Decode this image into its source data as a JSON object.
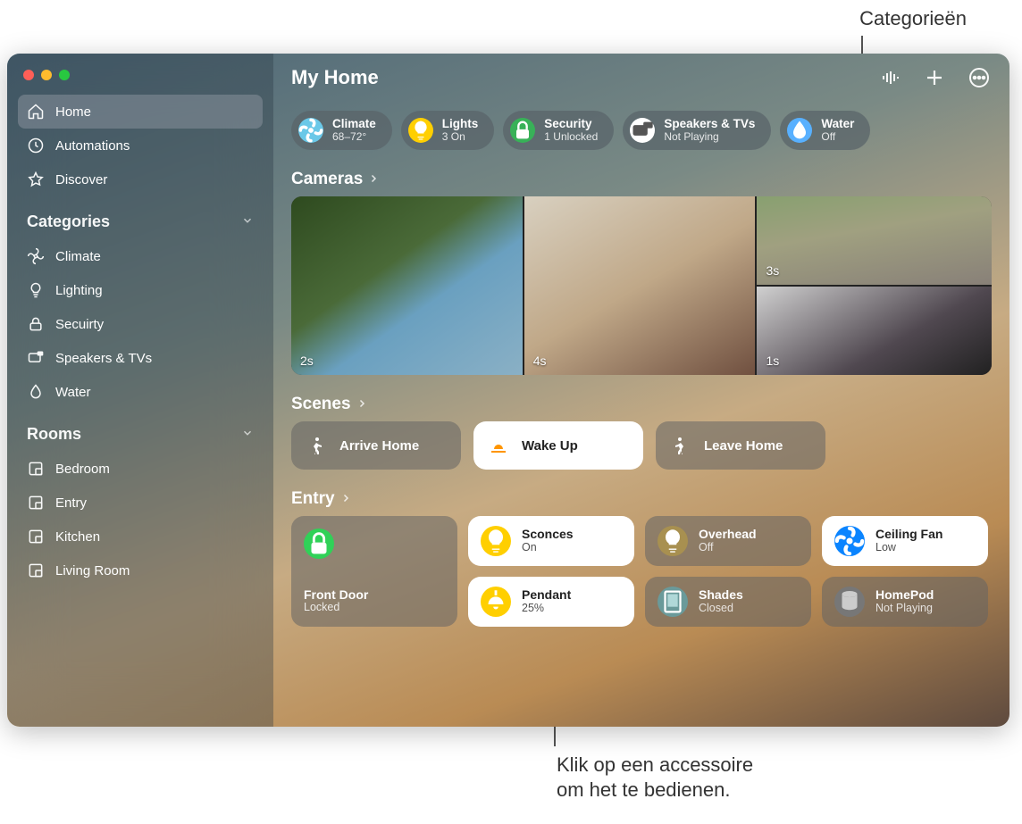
{
  "callouts": {
    "top": "Categorieën",
    "bottom1": "Klik op een accessoire",
    "bottom2": "om het te bedienen."
  },
  "title": "My Home",
  "sidebar": {
    "main": [
      {
        "label": "Home"
      },
      {
        "label": "Automations"
      },
      {
        "label": "Discover"
      }
    ],
    "categories_head": "Categories",
    "categories": [
      {
        "label": "Climate"
      },
      {
        "label": "Lighting"
      },
      {
        "label": "Secuirty"
      },
      {
        "label": "Speakers & TVs"
      },
      {
        "label": "Water"
      }
    ],
    "rooms_head": "Rooms",
    "rooms": [
      {
        "label": "Bedroom"
      },
      {
        "label": "Entry"
      },
      {
        "label": "Kitchen"
      },
      {
        "label": "Living Room"
      }
    ]
  },
  "pills": [
    {
      "label": "Climate",
      "status": "68–72°",
      "color": "#6ac8e8"
    },
    {
      "label": "Lights",
      "status": "3 On",
      "color": "#ffcf00"
    },
    {
      "label": "Security",
      "status": "1 Unlocked",
      "color": "#38b158"
    },
    {
      "label": "Speakers & TVs",
      "status": "Not Playing",
      "color": "#ffffff"
    },
    {
      "label": "Water",
      "status": "Off",
      "color": "#0a84ff"
    }
  ],
  "sections": {
    "cameras": "Cameras",
    "scenes": "Scenes",
    "entry": "Entry"
  },
  "cameras": [
    {
      "label": "2s"
    },
    {
      "label": "3s"
    },
    {
      "label": "4s"
    },
    {
      "label": "1s"
    }
  ],
  "scenes": [
    {
      "label": "Arrive Home",
      "style": "dark"
    },
    {
      "label": "Wake Up",
      "style": "light"
    },
    {
      "label": "Leave Home",
      "style": "dark"
    }
  ],
  "entry": {
    "front_door": {
      "name": "Front Door",
      "status": "Locked"
    },
    "tiles": [
      {
        "name": "Sconces",
        "status": "On",
        "style": "light",
        "icon": "bulb",
        "iclass": "ic-yellow"
      },
      {
        "name": "Overhead",
        "status": "Off",
        "style": "dark",
        "icon": "bulb",
        "iclass": "ic-yellow-dim"
      },
      {
        "name": "Ceiling Fan",
        "status": "Low",
        "style": "light",
        "icon": "fan",
        "iclass": "ic-blue"
      },
      {
        "name": "Pendant",
        "status": "25%",
        "style": "light",
        "icon": "pendant",
        "iclass": "ic-yellow"
      },
      {
        "name": "Shades",
        "status": "Closed",
        "style": "dark",
        "icon": "shades",
        "iclass": "ic-teal"
      },
      {
        "name": "HomePod",
        "status": "Not Playing",
        "style": "dark",
        "icon": "homepod",
        "iclass": "ic-grey"
      }
    ]
  }
}
